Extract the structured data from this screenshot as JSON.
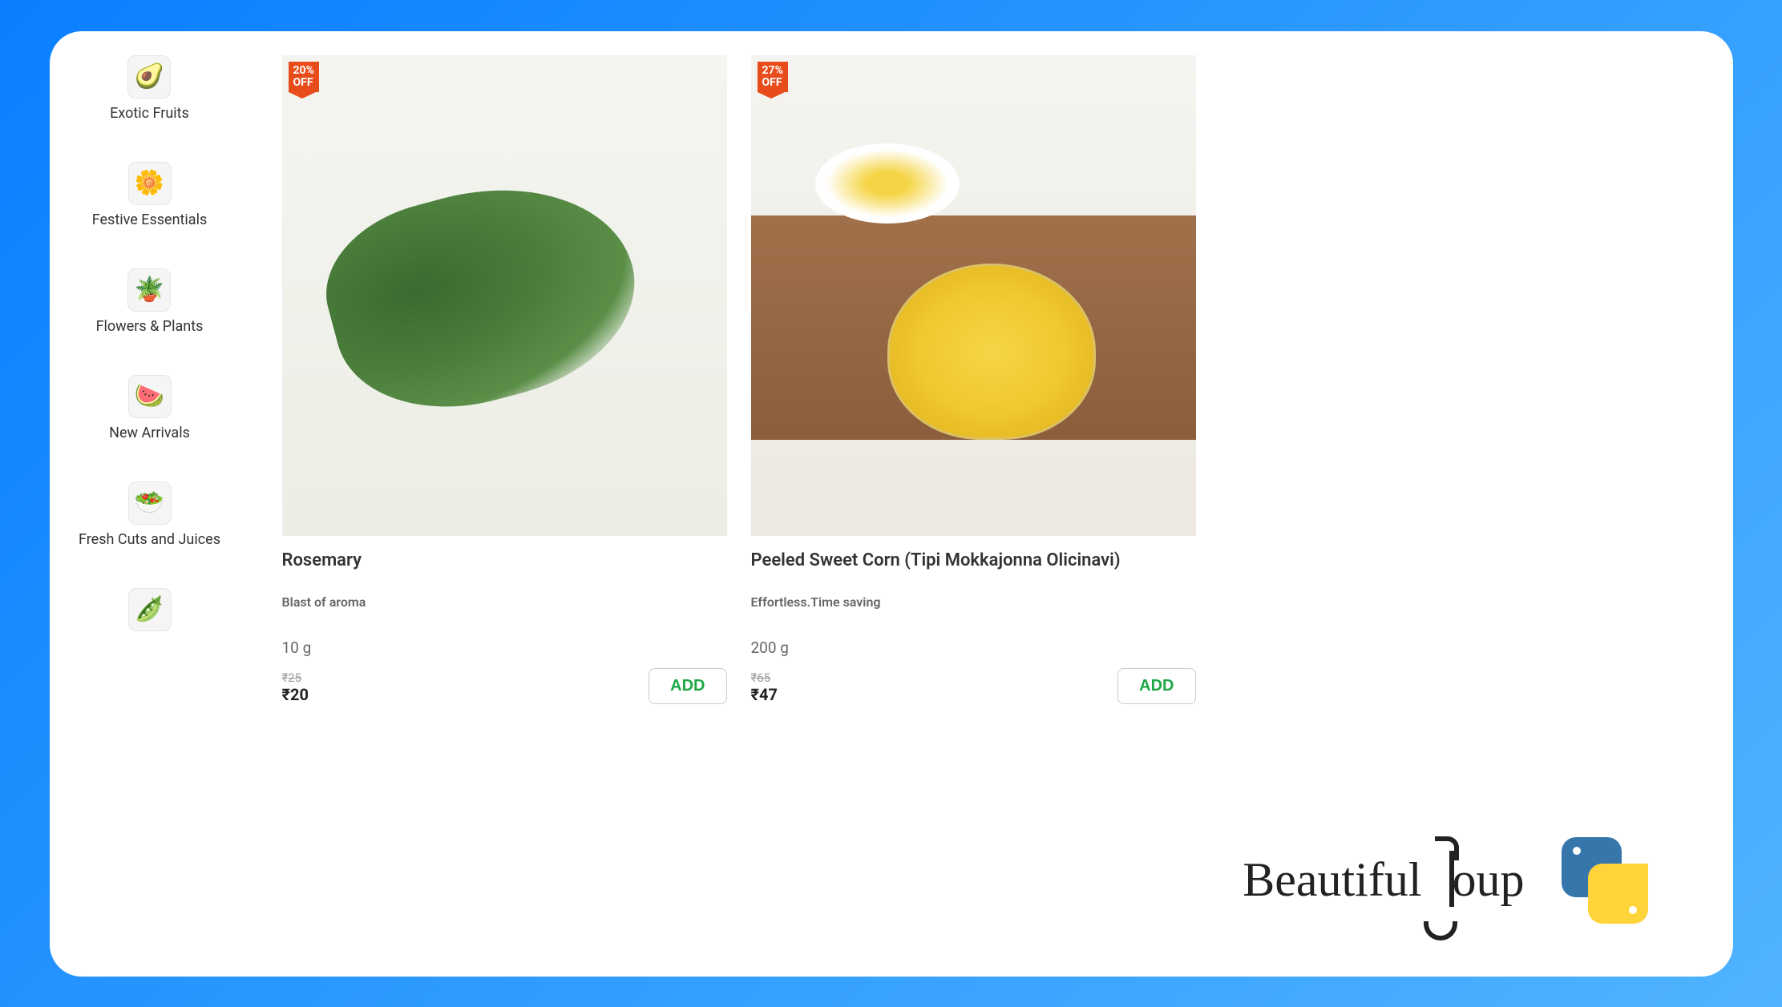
{
  "sidebar": {
    "items": [
      {
        "label": "Exotic Fruits",
        "icon": "🥑",
        "name": "exotic-fruits"
      },
      {
        "label": "Festive Essentials",
        "icon": "🌼",
        "name": "festive-essentials"
      },
      {
        "label": "Flowers & Plants",
        "icon": "🪴",
        "name": "flowers-plants"
      },
      {
        "label": "New Arrivals",
        "icon": "🍉",
        "name": "new-arrivals"
      },
      {
        "label": "Fresh Cuts and Juices",
        "icon": "🥗",
        "name": "fresh-cuts-juices"
      },
      {
        "label": "",
        "icon": "🫛",
        "name": "category-more"
      }
    ]
  },
  "products": [
    {
      "discount_line1": "20%",
      "discount_line2": "OFF",
      "title": "Rosemary",
      "tagline": "Blast of aroma",
      "weight": "10 g",
      "price_old": "₹25",
      "price_new": "₹20",
      "add_label": "ADD",
      "name": "rosemary"
    },
    {
      "discount_line1": "27%",
      "discount_line2": "OFF",
      "title": "Peeled Sweet Corn (Tipi Mokkajonna Olicinavi)",
      "tagline": "Effortless.Time saving",
      "weight": "200 g",
      "price_old": "₹65",
      "price_new": "₹47",
      "add_label": "ADD",
      "name": "peeled-sweet-corn"
    }
  ],
  "footer": {
    "bs_text_left": "Beautiful",
    "bs_text_right": "oup"
  }
}
